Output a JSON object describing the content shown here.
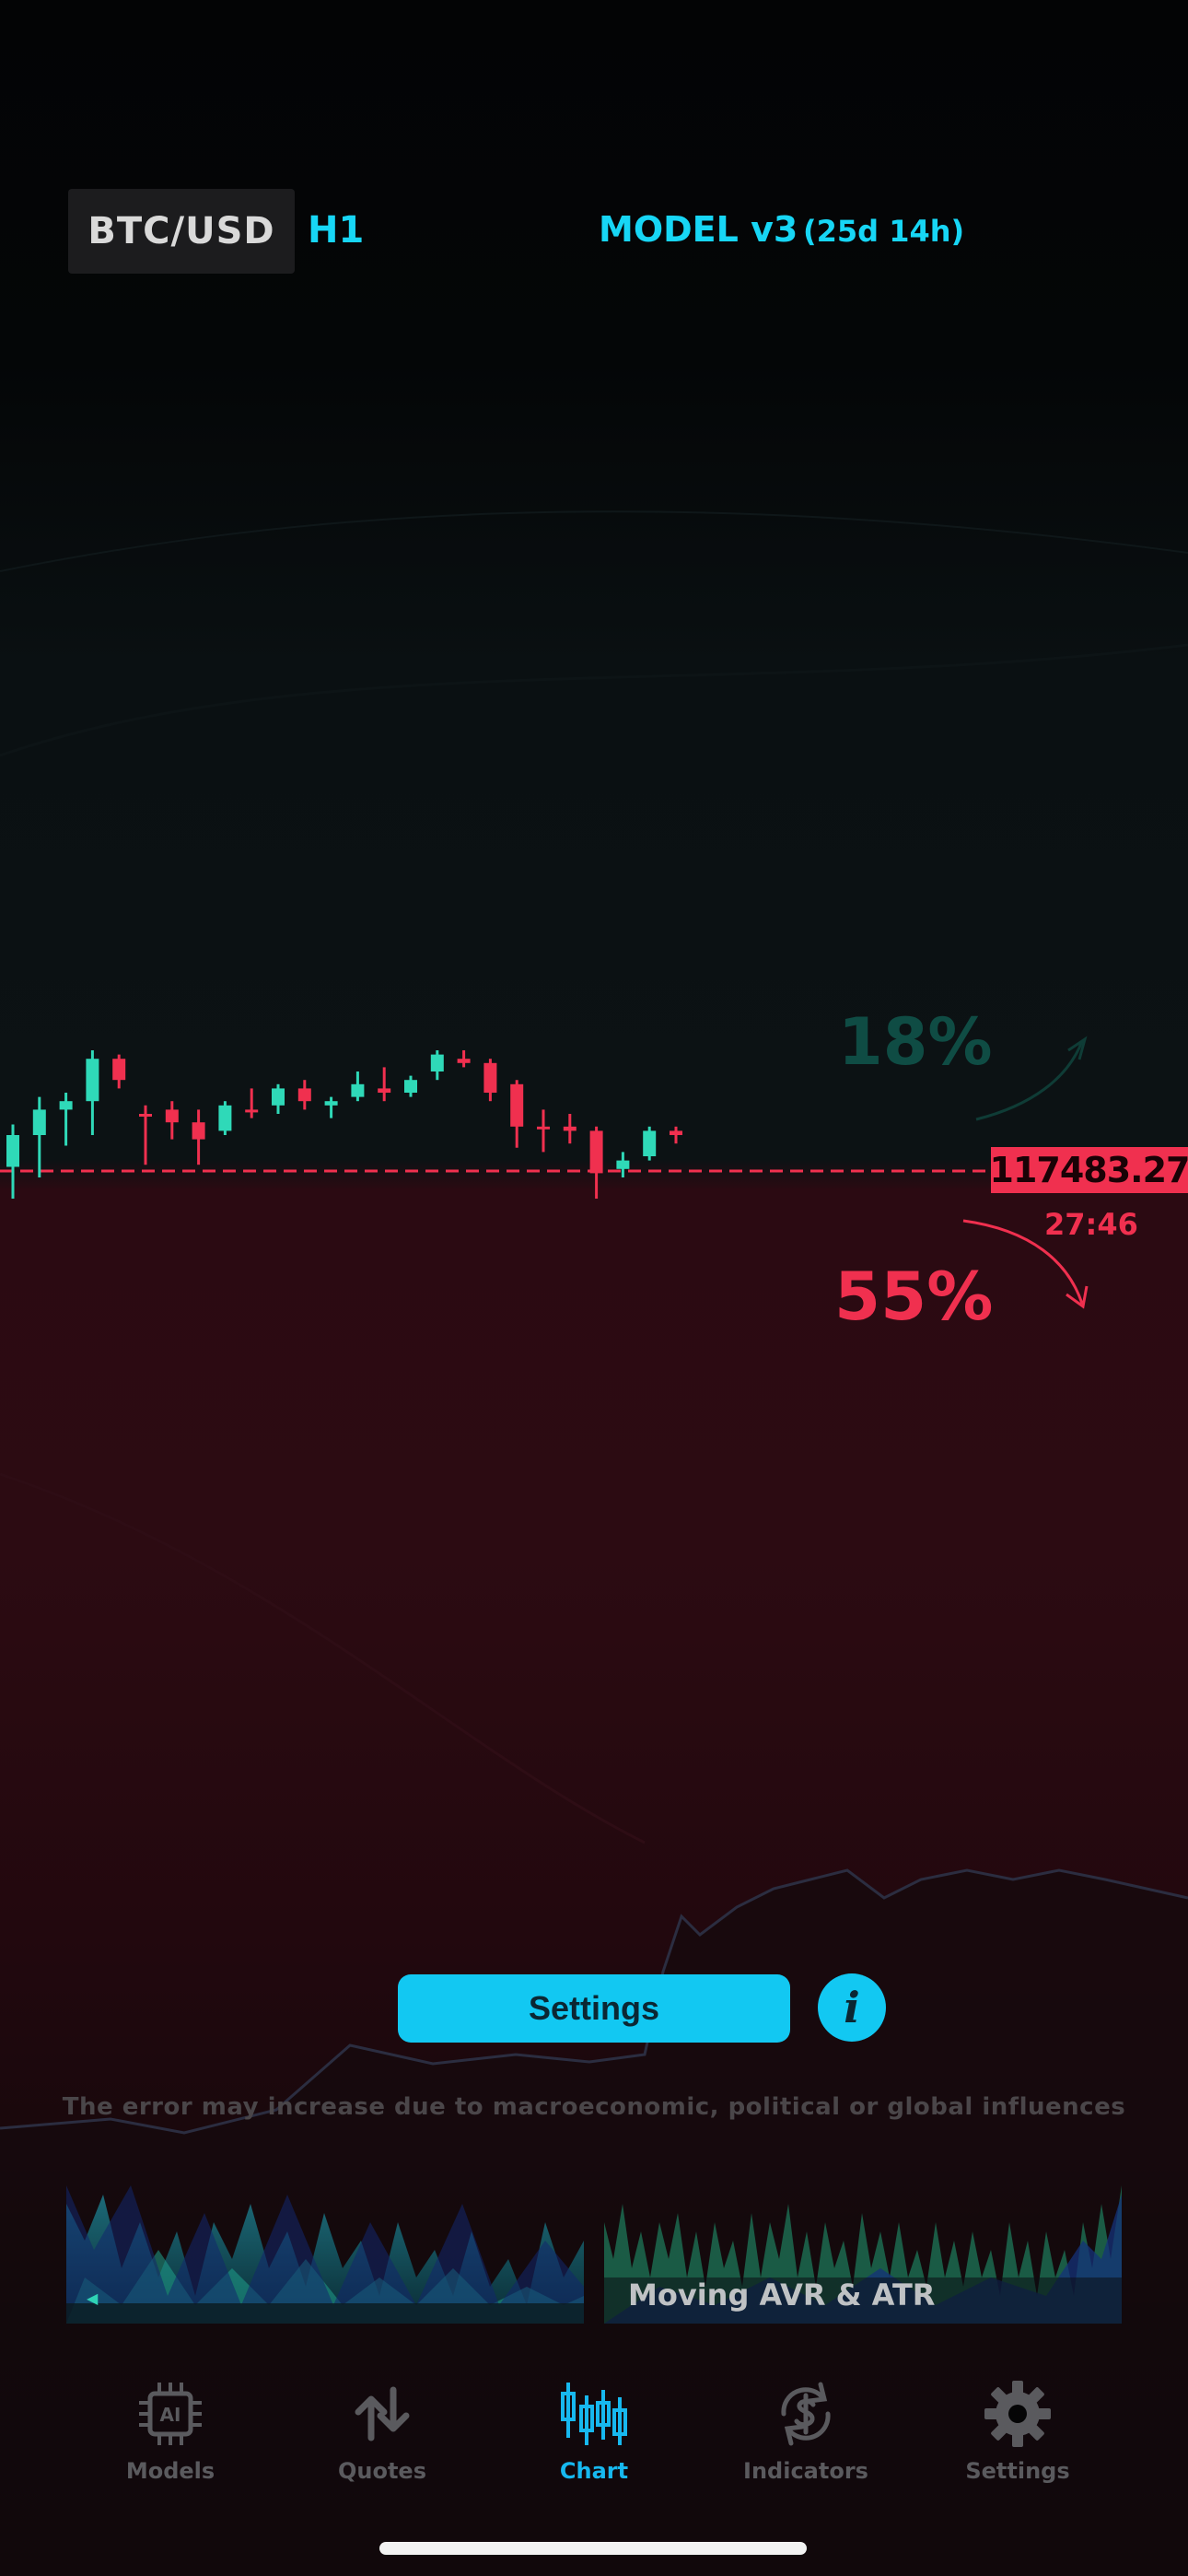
{
  "header": {
    "symbol": "BTC/USD",
    "timeframe": "H1",
    "model": "MODEL v3",
    "model_age": "(25d 14h)"
  },
  "forecast": {
    "up_probability": "18%",
    "down_probability": "55%",
    "current_price": "117483.27",
    "countdown": "27:46"
  },
  "chart_data": {
    "type": "candlestick",
    "price_line": 117483.27,
    "candles": [
      {
        "o": 0.45,
        "h": 0.65,
        "l": 0.3,
        "c": 0.6,
        "dir": "up"
      },
      {
        "o": 0.6,
        "h": 0.78,
        "l": 0.4,
        "c": 0.72,
        "dir": "up"
      },
      {
        "o": 0.72,
        "h": 0.8,
        "l": 0.55,
        "c": 0.76,
        "dir": "up"
      },
      {
        "o": 0.76,
        "h": 1.0,
        "l": 0.6,
        "c": 0.96,
        "dir": "up"
      },
      {
        "o": 0.96,
        "h": 0.98,
        "l": 0.82,
        "c": 0.86,
        "dir": "down"
      },
      {
        "o": 0.7,
        "h": 0.74,
        "l": 0.46,
        "c": 0.69,
        "dir": "down"
      },
      {
        "o": 0.72,
        "h": 0.76,
        "l": 0.58,
        "c": 0.66,
        "dir": "down"
      },
      {
        "o": 0.66,
        "h": 0.72,
        "l": 0.46,
        "c": 0.58,
        "dir": "down"
      },
      {
        "o": 0.62,
        "h": 0.76,
        "l": 0.6,
        "c": 0.74,
        "dir": "up"
      },
      {
        "o": 0.72,
        "h": 0.82,
        "l": 0.68,
        "c": 0.72,
        "dir": "down"
      },
      {
        "o": 0.74,
        "h": 0.84,
        "l": 0.7,
        "c": 0.82,
        "dir": "up"
      },
      {
        "o": 0.82,
        "h": 0.86,
        "l": 0.72,
        "c": 0.76,
        "dir": "down"
      },
      {
        "o": 0.74,
        "h": 0.78,
        "l": 0.68,
        "c": 0.76,
        "dir": "up"
      },
      {
        "o": 0.78,
        "h": 0.9,
        "l": 0.76,
        "c": 0.84,
        "dir": "up"
      },
      {
        "o": 0.82,
        "h": 0.92,
        "l": 0.76,
        "c": 0.8,
        "dir": "down"
      },
      {
        "o": 0.8,
        "h": 0.88,
        "l": 0.78,
        "c": 0.86,
        "dir": "up"
      },
      {
        "o": 0.9,
        "h": 1.0,
        "l": 0.86,
        "c": 0.98,
        "dir": "up"
      },
      {
        "o": 0.96,
        "h": 1.0,
        "l": 0.92,
        "c": 0.94,
        "dir": "down"
      },
      {
        "o": 0.94,
        "h": 0.96,
        "l": 0.76,
        "c": 0.8,
        "dir": "down"
      },
      {
        "o": 0.84,
        "h": 0.86,
        "l": 0.54,
        "c": 0.64,
        "dir": "down"
      },
      {
        "o": 0.64,
        "h": 0.72,
        "l": 0.52,
        "c": 0.64,
        "dir": "down"
      },
      {
        "o": 0.64,
        "h": 0.7,
        "l": 0.56,
        "c": 0.62,
        "dir": "down"
      },
      {
        "o": 0.62,
        "h": 0.64,
        "l": 0.3,
        "c": 0.42,
        "dir": "down"
      },
      {
        "o": 0.44,
        "h": 0.52,
        "l": 0.4,
        "c": 0.48,
        "dir": "up"
      },
      {
        "o": 0.5,
        "h": 0.64,
        "l": 0.48,
        "c": 0.62,
        "dir": "up"
      },
      {
        "o": 0.62,
        "h": 0.64,
        "l": 0.56,
        "c": 0.6,
        "dir": "down"
      }
    ]
  },
  "actions": {
    "settings_label": "Settings",
    "info_label": "i"
  },
  "disclaimer": "The error may increase due to macroeconomic, political or global influences",
  "cards": [
    {
      "title": ""
    },
    {
      "title": "Moving AVR & ATR"
    }
  ],
  "tabs": [
    {
      "label": "Models",
      "icon": "ai-chip-icon",
      "active": false
    },
    {
      "label": "Quotes",
      "icon": "up-down-arrows-icon",
      "active": false
    },
    {
      "label": "Chart",
      "icon": "candlestick-icon",
      "active": true
    },
    {
      "label": "Indicators",
      "icon": "refresh-dollar-icon",
      "active": false
    },
    {
      "label": "Settings",
      "icon": "gear-icon",
      "active": false
    }
  ],
  "colors": {
    "accent": "#17d6f5",
    "up": "#2fd9b8",
    "down": "#f0304f",
    "inactive": "#5a5a5e"
  }
}
